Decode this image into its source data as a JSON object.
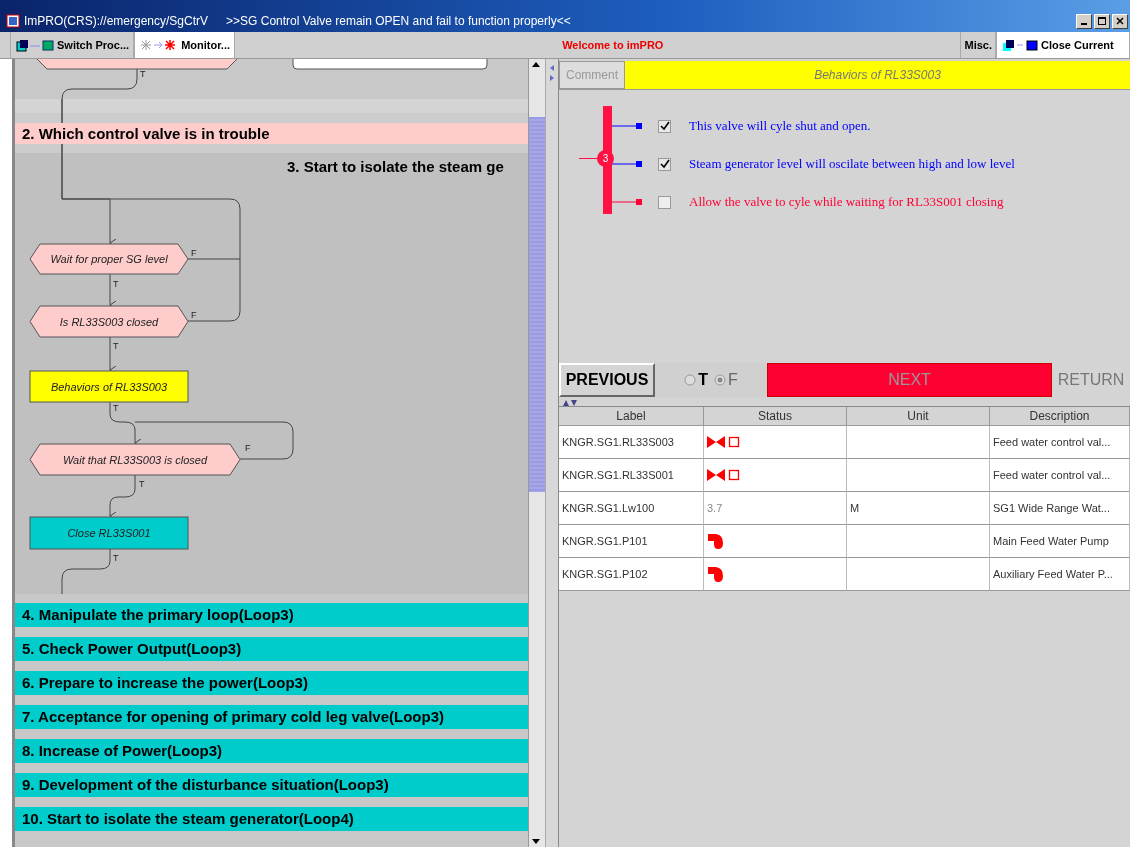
{
  "window": {
    "title": "ImPRO(CRS)://emergency/SgCtrV",
    "message": ">>SG Control Valve remain OPEN and fail to function properly<<"
  },
  "toolbar": {
    "left_buttons": [
      {
        "label": "Switch Proc..."
      },
      {
        "label": "Monitor..."
      }
    ],
    "welcome": "Welcome to imPRO",
    "misc": "Misc.",
    "close_current": "Close Current"
  },
  "flowchart": {
    "sections": [
      {
        "title": "2. Which control valve is in trouble"
      },
      {
        "title": "3. Start to isolate the steam ge"
      }
    ],
    "nodes": [
      {
        "kind": "wait",
        "text": "Wait for proper SG level",
        "color": "#ffcccc"
      },
      {
        "kind": "wait",
        "text": "Is RL33S003 closed",
        "color": "#ffcccc"
      },
      {
        "kind": "action",
        "text": "Behaviors of RL33S003",
        "color": "#ffff00"
      },
      {
        "kind": "wait",
        "text": "Wait that RL33S003 is closed",
        "color": "#ffcccc"
      },
      {
        "kind": "action",
        "text": "Close RL33S001",
        "color": "#00cccc"
      }
    ],
    "edge_labels": [
      "T",
      "T",
      "F",
      "T",
      "F",
      "T",
      "T",
      "F",
      "T"
    ]
  },
  "sections": [
    "4. Manipulate the primary loop(Loop3)",
    "5. Check Power Output(Loop3)",
    "6. Prepare to increase the power(Loop3)",
    "7. Acceptance for opening of primary cold leg valve(Loop3)",
    "8. Increase of Power(Loop3)",
    "9. Development of the disturbance situation(Loop3)",
    "10. Start to isolate the steam generator(Loop4)"
  ],
  "comment": {
    "tab": "Comment",
    "title": "Behaviors of RL33S003",
    "step": "3",
    "items": [
      {
        "text": "This valve will cyle shut and open.",
        "checked": true,
        "color": "#0000ff"
      },
      {
        "text": "Steam generator level will oscilate between high and low level",
        "checked": true,
        "color": "#0000ff"
      },
      {
        "text": "Allow the valve to cyle while waiting for RL33S001 closing",
        "checked": false,
        "color": "#ff0033"
      }
    ]
  },
  "nav": {
    "previous": "PREVIOUS",
    "options": [
      {
        "label": "T",
        "selected": false
      },
      {
        "label": "F",
        "selected": true
      }
    ],
    "next": "NEXT",
    "return": {
      "label": "RETURN",
      "disabled": true
    }
  },
  "table": {
    "columns": [
      "Label",
      "Status",
      "Unit",
      "Description"
    ],
    "rows": [
      {
        "label": "KNGR.SG1.RL33S003",
        "status": {
          "kind": "valve"
        },
        "description": "Feed water control val..."
      },
      {
        "label": "KNGR.SG1.RL33S001",
        "status": {
          "kind": "valve"
        },
        "description": "Feed water control val..."
      },
      {
        "label": "KNGR.SG1.Lw100",
        "status": {
          "kind": "value",
          "text": "3.7"
        },
        "unit": "M",
        "description": "SG1 Wide Range Wat..."
      },
      {
        "label": "KNGR.SG1.P101",
        "status": {
          "kind": "pump"
        },
        "description": "Main Feed Water Pump"
      },
      {
        "label": "KNGR.SG1.P102",
        "status": {
          "kind": "pump"
        },
        "description": "Auxiliary Feed Water P..."
      }
    ]
  }
}
